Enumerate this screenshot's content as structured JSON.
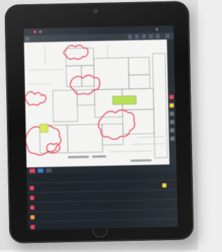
{
  "app": {
    "title": "",
    "document_title": ""
  },
  "colors": {
    "cloud_markup": "#e8465a",
    "highlight": "#b8e05a",
    "screen_bg": "#1e2328",
    "drawing_bg": "#f4f4f2",
    "flag": "#f2d23a"
  },
  "markups_panel": {
    "title": "",
    "rows": [
      {
        "text": ""
      },
      {
        "text": ""
      },
      {
        "text": ""
      },
      {
        "text": ""
      },
      {
        "text": ""
      }
    ]
  }
}
